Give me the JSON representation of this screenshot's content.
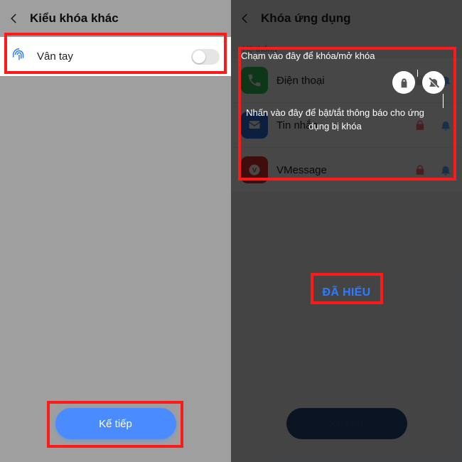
{
  "left": {
    "title": "Kiểu khóa khác",
    "row": {
      "label": "Vân tay"
    },
    "next_label": "Kế tiếp"
  },
  "right": {
    "title": "Khóa ứng dụng",
    "section": "Hệ thống",
    "tip_lock": "Chạm vào đây để khóa/mở khóa",
    "tip_notify": "Nhấn vào đây để bật/tắt thông báo cho ứng dụng bị khóa",
    "apps": [
      {
        "name": "Điện thoại"
      },
      {
        "name": "Tin nhắn"
      },
      {
        "name": "VMessage"
      }
    ],
    "got_it": "ĐÃ HIỂU",
    "next_label": "Kế tiếp"
  }
}
